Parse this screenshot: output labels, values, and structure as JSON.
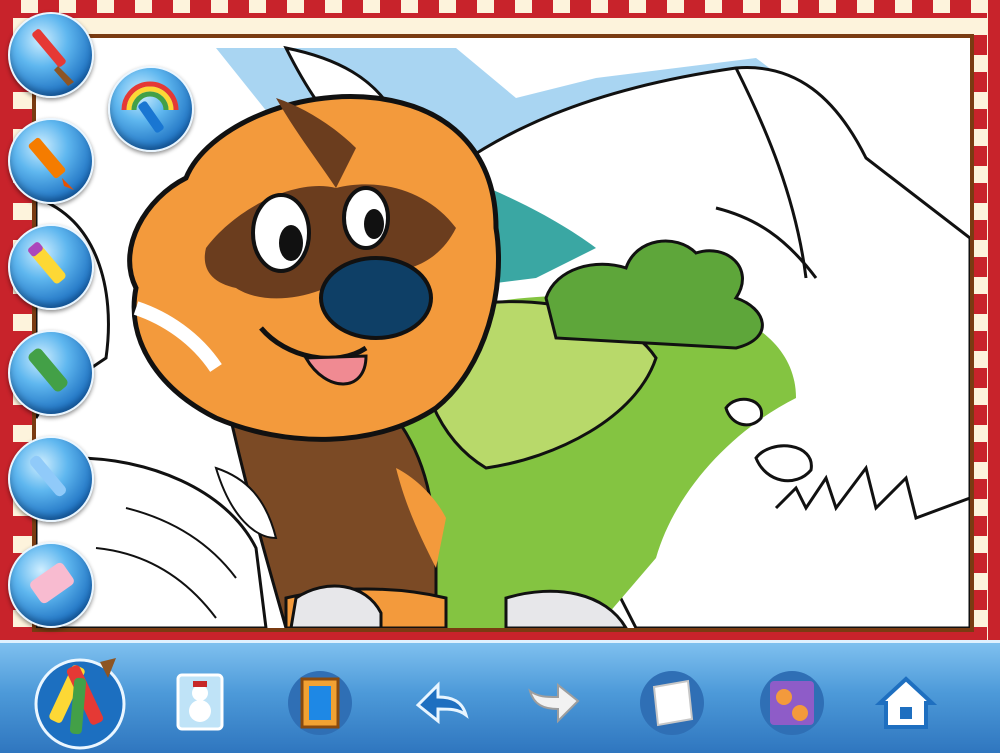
{
  "app": {
    "screen": "coloring-page"
  },
  "left_tools": [
    "paintbrush",
    "crayon",
    "marker",
    "felt-pen",
    "chalk",
    "eraser"
  ],
  "selected_tool": "rainbow-brush",
  "toolbar": [
    "coloring-tools",
    "pictures",
    "frames",
    "undo",
    "redo",
    "new-page",
    "gallery",
    "home"
  ],
  "colors": {
    "border_red": "#c8232b",
    "border_cream": "#fdf3dc",
    "frame_brown": "#7a3b12",
    "toolbar_blue": "#4d9ad9",
    "dog_orange": "#f39a3c",
    "dog_brown": "#7b4a25",
    "grass_green": "#7fc242",
    "sky_blue": "#a6d3f1"
  }
}
